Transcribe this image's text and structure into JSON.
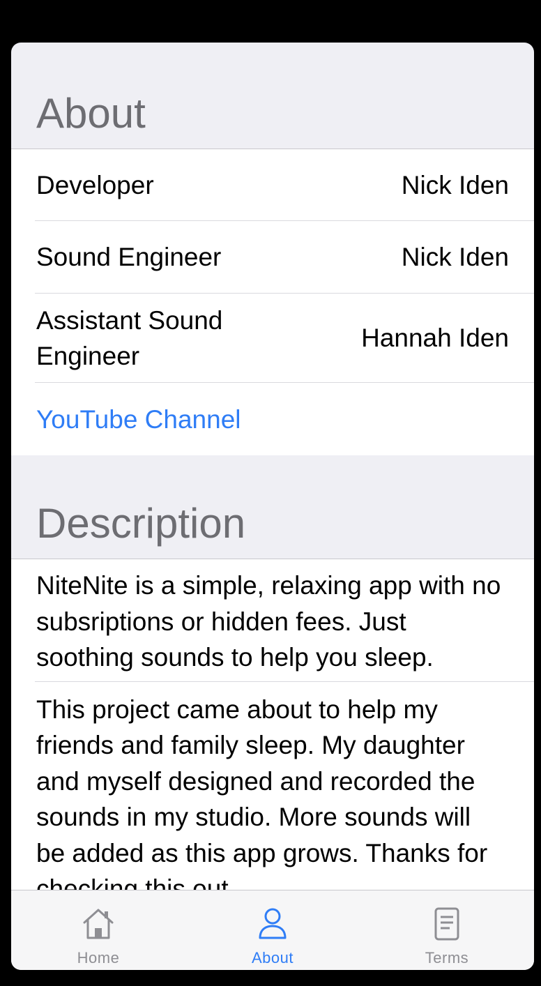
{
  "about": {
    "title": "About",
    "rows": [
      {
        "label": "Developer",
        "value": "Nick Iden"
      },
      {
        "label": "Sound Engineer",
        "value": "Nick Iden"
      },
      {
        "label": "Assistant Sound Engineer",
        "value": "Hannah Iden"
      }
    ],
    "youtube_link": "YouTube Channel"
  },
  "description": {
    "title": "Description",
    "paragraphs": [
      "NiteNite is a simple, relaxing app with no subsriptions or hidden fees. Just soothing sounds to help you sleep.",
      "This project came about to help my friends and family sleep. My daughter and myself designed and recorded the sounds in my studio. More sounds will be added as this app grows. Thanks for checking this out."
    ]
  },
  "tabbar": {
    "tabs": [
      {
        "label": "Home",
        "icon": "house-icon",
        "active": false
      },
      {
        "label": "About",
        "icon": "person-icon",
        "active": true
      },
      {
        "label": "Terms",
        "icon": "document-icon",
        "active": false
      }
    ]
  },
  "colors": {
    "accent": "#2f7df6",
    "inactive": "#8e8e93",
    "header_text": "#6d6d72",
    "grouped_background": "#efeff4"
  }
}
